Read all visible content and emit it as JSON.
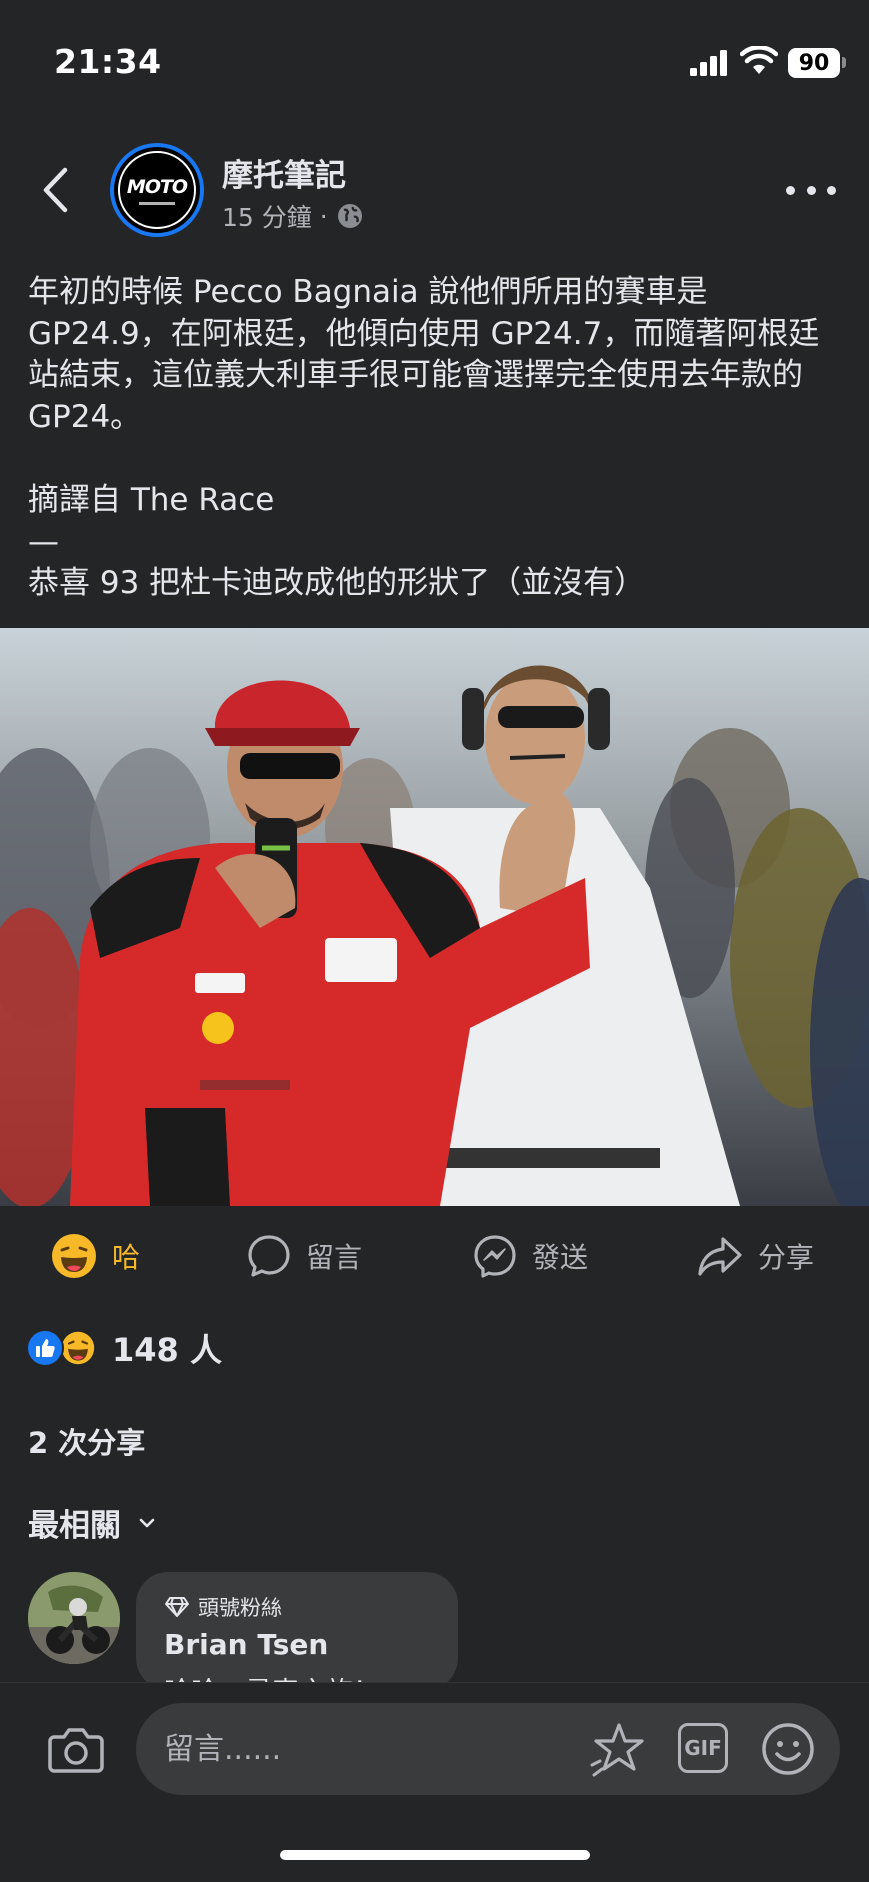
{
  "status_bar": {
    "time": "21:34",
    "battery": "90"
  },
  "header": {
    "page_name": "摩托筆記",
    "time_ago": "15 分鐘",
    "separator": "·",
    "avatar_logo_text": "MOTO"
  },
  "post": {
    "paragraph1": "年初的時候 Pecco Bagnaia 說他們所用的賽車是 GP24.9，在阿根廷，他傾向使用 GP24.7，而隨著阿根廷站結束，這位義大利車手很可能會選擇完全使用去年款的 GP24。",
    "paragraph2": "摘譯自 The Race",
    "divider": "—",
    "paragraph3": "恭喜 93 把杜卡迪改成他的形狀了（並沒有）"
  },
  "actions": {
    "react_label": "哈",
    "comment_label": "留言",
    "send_label": "發送",
    "share_label": "分享"
  },
  "reactions": {
    "count": "148 人"
  },
  "shares": {
    "label": "2 次分享"
  },
  "comments": {
    "sort_label": "最相關",
    "first": {
      "badge": "頭號粉絲",
      "name": "Brian Tsen",
      "text": "哈哈，尋車之旅！"
    }
  },
  "composer": {
    "placeholder": "留言......",
    "gif_label": "GIF"
  },
  "colors": {
    "background": "#242526",
    "accent_blue": "#1877f2",
    "haha_yellow": "#f7b928",
    "secondary_text": "#b0b3b8"
  }
}
